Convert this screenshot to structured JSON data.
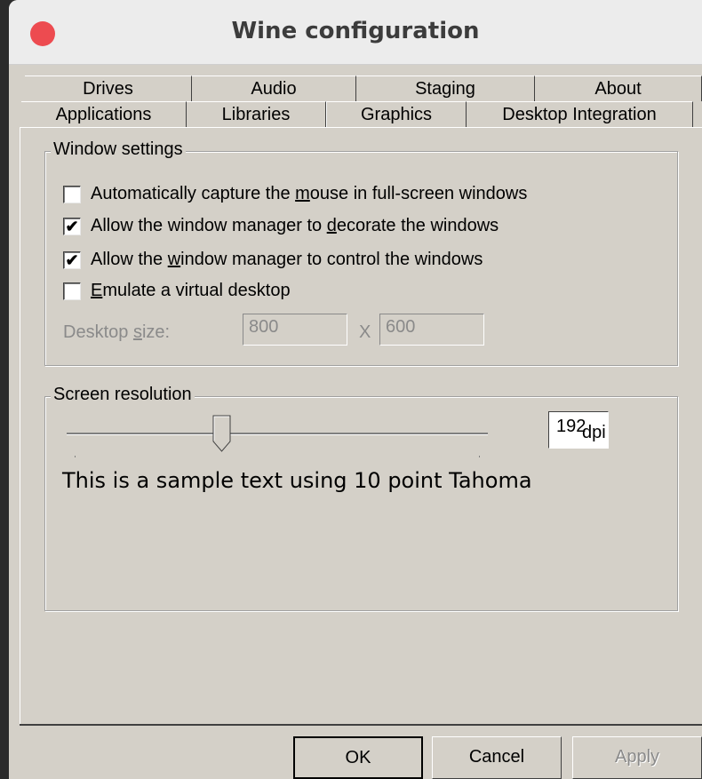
{
  "window": {
    "title": "Wine configuration"
  },
  "tabs": {
    "row1": [
      "Drives",
      "Audio",
      "Staging",
      "About"
    ],
    "row2": [
      "Applications",
      "Libraries",
      "Graphics",
      "Desktop Integration"
    ],
    "selected": "Graphics"
  },
  "window_settings": {
    "legend": "Window settings",
    "options": [
      {
        "label": "Automatically capture the mouse in full-screen windows",
        "checked": false
      },
      {
        "label": "Allow the window manager to decorate the windows",
        "checked": true
      },
      {
        "label": "Allow the window manager to control the windows",
        "checked": true
      },
      {
        "label": "Emulate a virtual desktop",
        "checked": false
      }
    ],
    "desktop_size_label": "Desktop size:",
    "width_value": "800",
    "separator": "X",
    "height_value": "600"
  },
  "screen_resolution": {
    "legend": "Screen resolution",
    "dpi_value": "192",
    "dpi_unit": "dpi",
    "sample_text": "This is a sample text using 10 point Tahoma"
  },
  "buttons": {
    "ok": "OK",
    "cancel": "Cancel",
    "apply": "Apply"
  },
  "colors": {
    "dialog_bg": "#d4d0c8",
    "close_button": "#ed4b50",
    "titlebar": "#ececec",
    "disabled_text": "#8a8a8a"
  },
  "icons": {
    "close": "close-icon",
    "checkmark": "checkmark-icon"
  }
}
